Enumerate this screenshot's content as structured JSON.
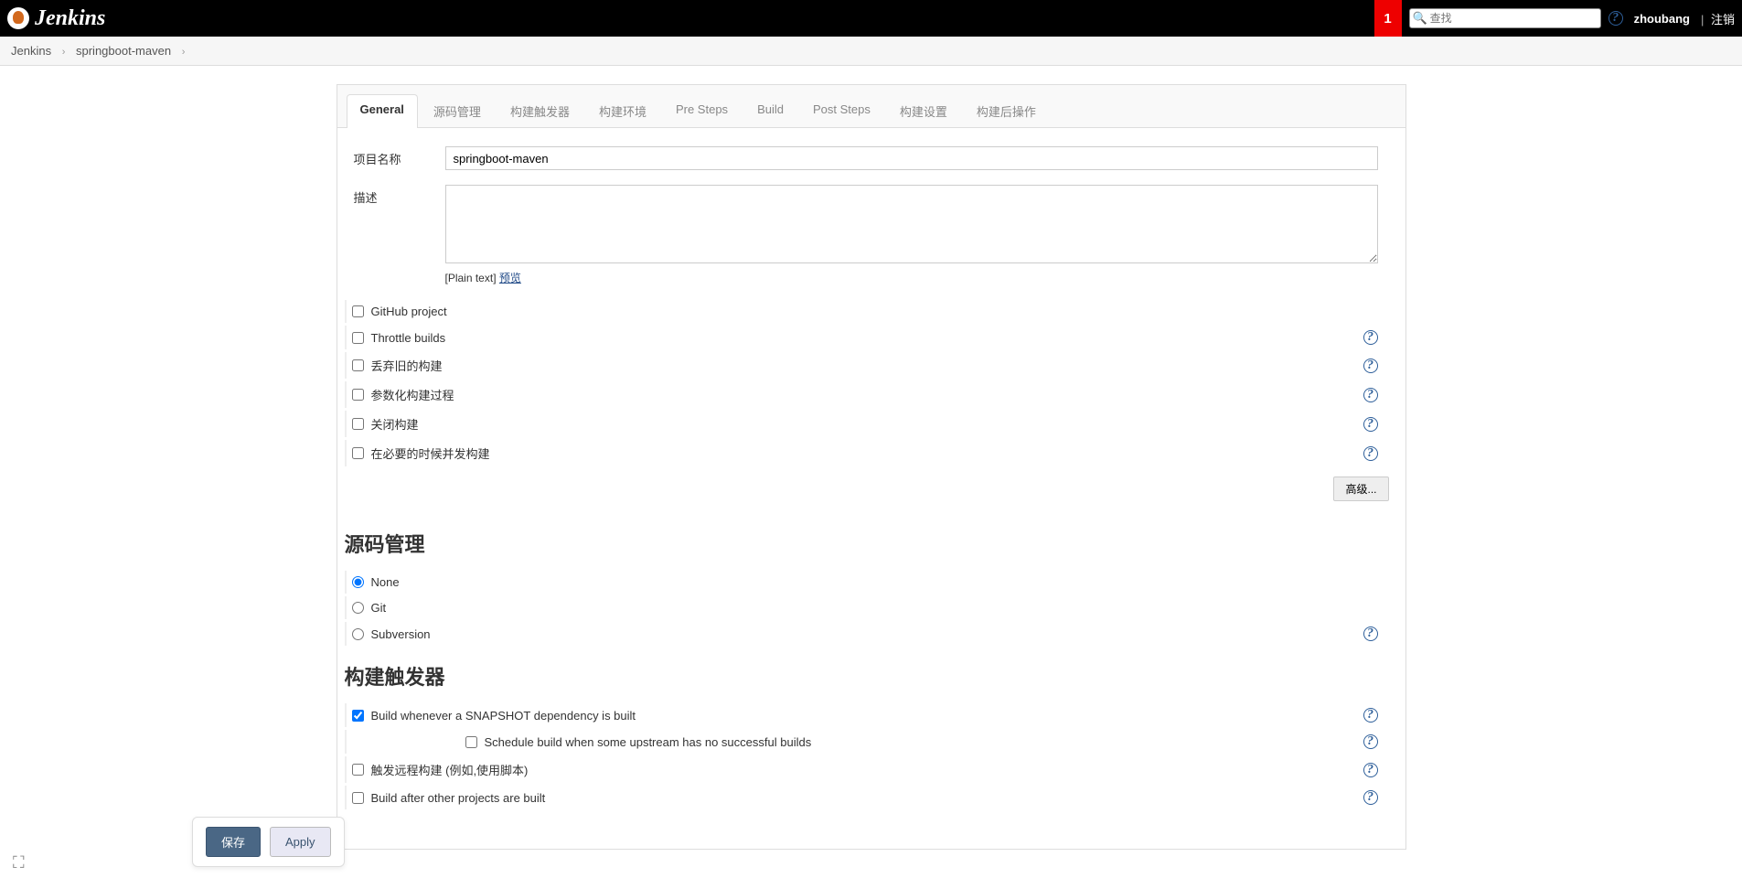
{
  "header": {
    "logo_text": "Jenkins",
    "notif_count": "1",
    "search_placeholder": "查找",
    "username": "zhoubang",
    "logout": "注销"
  },
  "breadcrumbs": [
    "Jenkins",
    "springboot-maven"
  ],
  "tabs": [
    "General",
    "源码管理",
    "构建触发器",
    "构建环境",
    "Pre Steps",
    "Build",
    "Post Steps",
    "构建设置",
    "构建后操作"
  ],
  "general": {
    "project_name_label": "项目名称",
    "project_name_value": "springboot-maven",
    "description_label": "描述",
    "description_value": "",
    "plain_text": "[Plain text]",
    "preview": "预览",
    "checkboxes": [
      {
        "label": "GitHub project",
        "help": false
      },
      {
        "label": "Throttle builds",
        "help": true
      },
      {
        "label": "丢弃旧的构建",
        "help": true
      },
      {
        "label": "参数化构建过程",
        "help": true
      },
      {
        "label": "关闭构建",
        "help": true
      },
      {
        "label": "在必要的时候并发构建",
        "help": true
      }
    ],
    "advanced_btn": "高级..."
  },
  "scm": {
    "heading": "源码管理",
    "options": [
      {
        "label": "None",
        "checked": true,
        "help": false
      },
      {
        "label": "Git",
        "checked": false,
        "help": false
      },
      {
        "label": "Subversion",
        "checked": false,
        "help": true
      }
    ]
  },
  "triggers": {
    "heading": "构建触发器",
    "items": [
      {
        "label": "Build whenever a SNAPSHOT dependency is built",
        "checked": true,
        "help": true
      },
      {
        "label": "Schedule build when some upstream has no successful builds",
        "checked": false,
        "help": true,
        "sub": true
      },
      {
        "label": "触发远程构建 (例如,使用脚本)",
        "checked": false,
        "help": true
      },
      {
        "label": "Build after other projects are built",
        "checked": false,
        "help": true
      }
    ]
  },
  "buttons": {
    "save": "保存",
    "apply": "Apply"
  }
}
